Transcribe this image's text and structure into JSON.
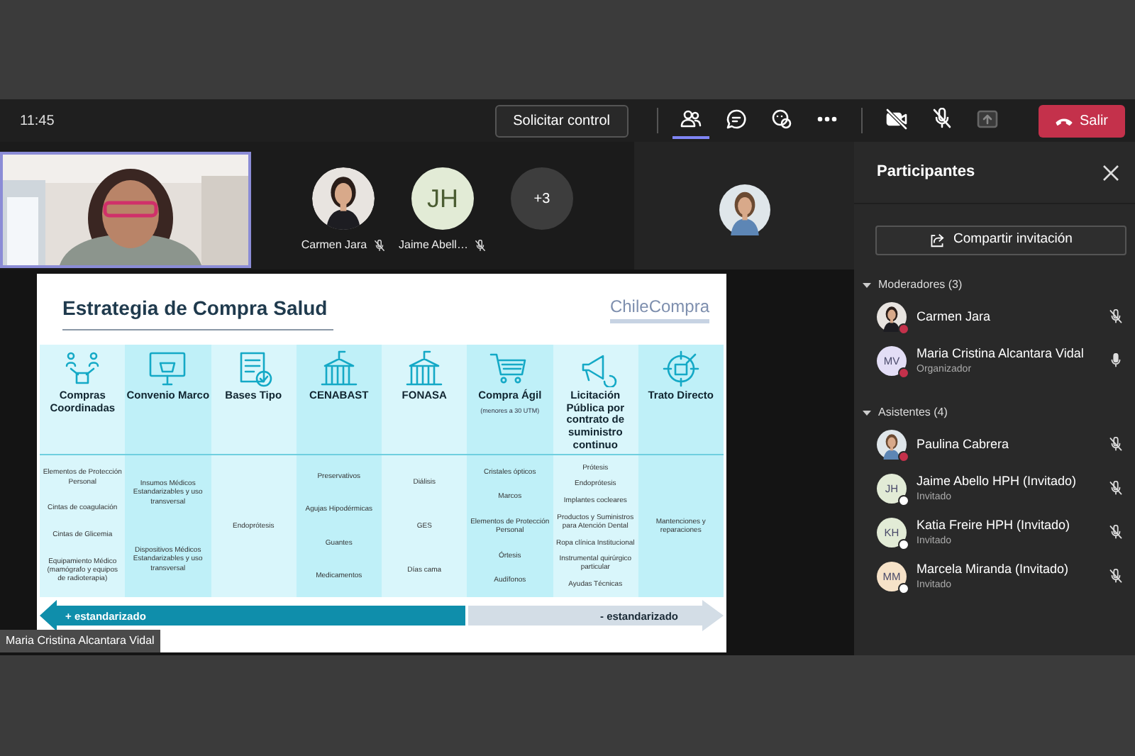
{
  "top_bar": {
    "time": "11:45",
    "request_control_button": "Solicitar control",
    "toolbar": [
      {
        "kind": "participants",
        "selected": true
      },
      {
        "kind": "chat",
        "selected": false
      },
      {
        "kind": "reactions",
        "selected": false
      },
      {
        "kind": "more",
        "selected": false
      },
      {
        "kind": "camera-off",
        "selected": false
      },
      {
        "kind": "mic-off",
        "selected": false
      },
      {
        "kind": "share",
        "selected": false
      }
    ],
    "leave_button": "Salir"
  },
  "stage": {
    "tiles": [
      {
        "name": "Carmen Jara",
        "muted": true
      },
      {
        "kind": "initials",
        "initials": "JH",
        "name": "Jaime Abell…",
        "muted": true
      },
      {
        "kind": "overflow",
        "count": "+3"
      }
    ],
    "presenter_label": "Maria Cristina Alcantara Vidal",
    "slide": {
      "title": "Estrategia de Compra Salud",
      "logo": "ChileCompra",
      "columns": [
        {
          "title": "Compras Coordinadas",
          "items": [
            "Elementos de Protección Personal",
            "Cintas de coagulación",
            "Cintas de Glicemia",
            "Equipamiento Médico (mamógrafo y equipos de radioterapia)"
          ]
        },
        {
          "title": "Convenio Marco",
          "items": [
            "Insumos Médicos Estandarizables y uso transversal",
            "Dispositivos Médicos Estandarizables y uso transversal"
          ]
        },
        {
          "title": "Bases Tipo",
          "items": [
            "Endoprótesis"
          ]
        },
        {
          "title": "CENABAST",
          "items": [
            "Preservativos",
            "Agujas Hipodérmicas",
            "Guantes",
            "Medicamentos"
          ]
        },
        {
          "title": "FONASA",
          "items": [
            "Diálisis",
            "GES",
            "Días cama"
          ]
        },
        {
          "title": "Compra Ágil",
          "note": "(menores a 30 UTM)",
          "items": [
            "Cristales ópticos",
            "Marcos",
            "Elementos de Protección Personal",
            "Órtesis",
            "Audífonos"
          ]
        },
        {
          "title": "Licitación Pública por contrato de suministro continuo",
          "items": [
            "Prótesis",
            "Endoprótesis",
            "Implantes cocleares",
            "Productos y Suministros para Atención Dental",
            "Ropa clínica Institucional",
            "Instrumental quirúrgico particular",
            "Ayudas Técnicas"
          ]
        },
        {
          "title": "Trato Directo",
          "items": [
            "Mantenciones y reparaciones"
          ]
        }
      ],
      "arrows": [
        {
          "label": "+ estandarizado",
          "color": "#0f8eab"
        },
        {
          "label": "- estandarizado",
          "color": "#d3dde6"
        }
      ]
    }
  },
  "participants": {
    "title": "Participantes",
    "invite_button": "Compartir invitación",
    "groups": [
      {
        "title": "Moderadores (3)",
        "expanded": true,
        "people": [
          {
            "name": "Carmen Jara",
            "color": "#c4314b",
            "muted": true
          },
          {
            "name": "Maria Cristina Alcantara Vidal",
            "role": "Organizador",
            "avatar": {
              "kind": "initials",
              "initials": "MV",
              "color": "#e3def6"
            },
            "color": "#c4314b",
            "muted": false
          }
        ]
      },
      {
        "title": "Asistentes (4)",
        "expanded": true,
        "people": [
          {
            "name": "Paulina Cabrera",
            "color": "#c4314b",
            "muted": true
          },
          {
            "name": "Jaime Abello HPH (Invitado)",
            "role": "Invitado",
            "avatar": {
              "kind": "initials",
              "initials": "JH",
              "color": "#e2ebd6"
            },
            "color": "#ffffff",
            "muted": true
          },
          {
            "name": "Katia Freire HPH (Invitado)",
            "role": "Invitado",
            "avatar": {
              "kind": "initials",
              "initials": "KH",
              "color": "#e2ebd6"
            },
            "color": "#ffffff",
            "muted": true
          },
          {
            "name": "Marcela Miranda (Invitado)",
            "role": "Invitado",
            "avatar": {
              "kind": "initials",
              "initials": "MM",
              "color": "#f6e2c8"
            },
            "color": "#ffffff",
            "muted": true
          }
        ]
      }
    ]
  }
}
